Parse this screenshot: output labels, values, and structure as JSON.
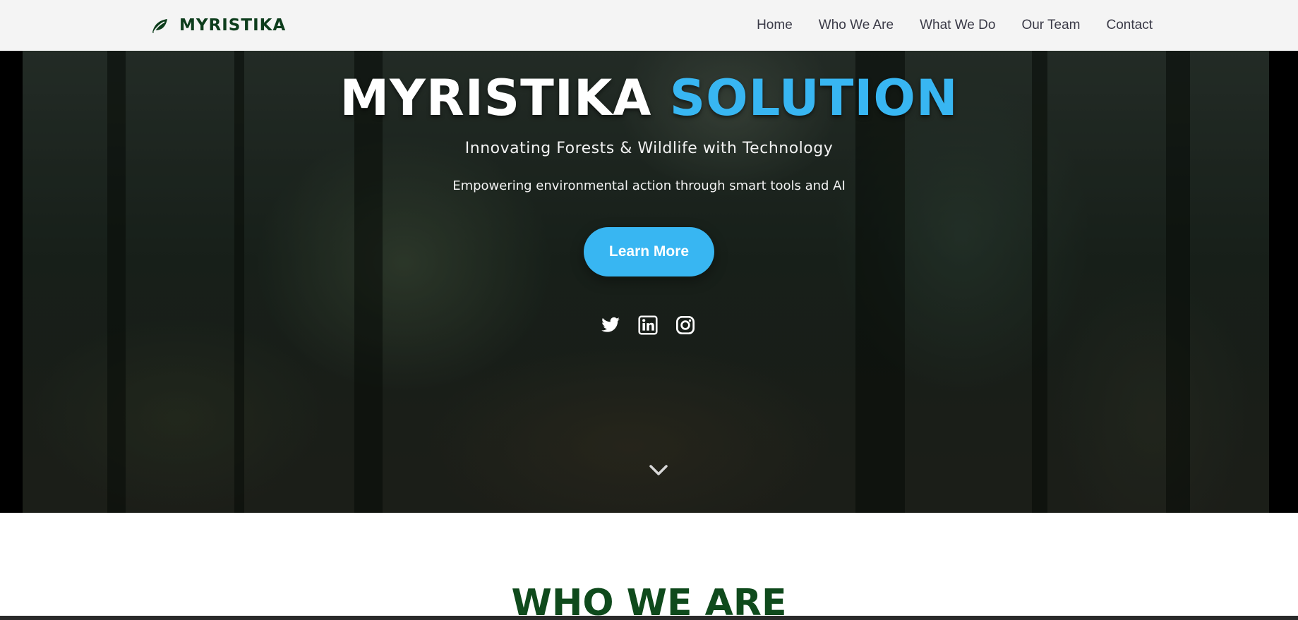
{
  "brand": {
    "name": "MYRISTIKA",
    "icon": "leaf-icon",
    "color": "#0d3d1c"
  },
  "nav": {
    "items": [
      {
        "label": "Home"
      },
      {
        "label": "Who We Are"
      },
      {
        "label": "What We Do"
      },
      {
        "label": "Our Team"
      },
      {
        "label": "Contact"
      }
    ]
  },
  "hero": {
    "title_part1": "MYRISTIKA",
    "title_part2": "SOLUTION",
    "subtitle": "Innovating Forests & Wildlife with Technology",
    "tagline": "Empowering environmental action through smart tools and AI",
    "cta_label": "Learn More",
    "accent_color": "#38b6f2",
    "social_icons": [
      "twitter-icon",
      "linkedin-icon",
      "instagram-icon"
    ],
    "scroll_icon": "chevron-down-icon"
  },
  "who_we_are": {
    "title": "WHO WE ARE",
    "color": "#0f4a1c"
  }
}
